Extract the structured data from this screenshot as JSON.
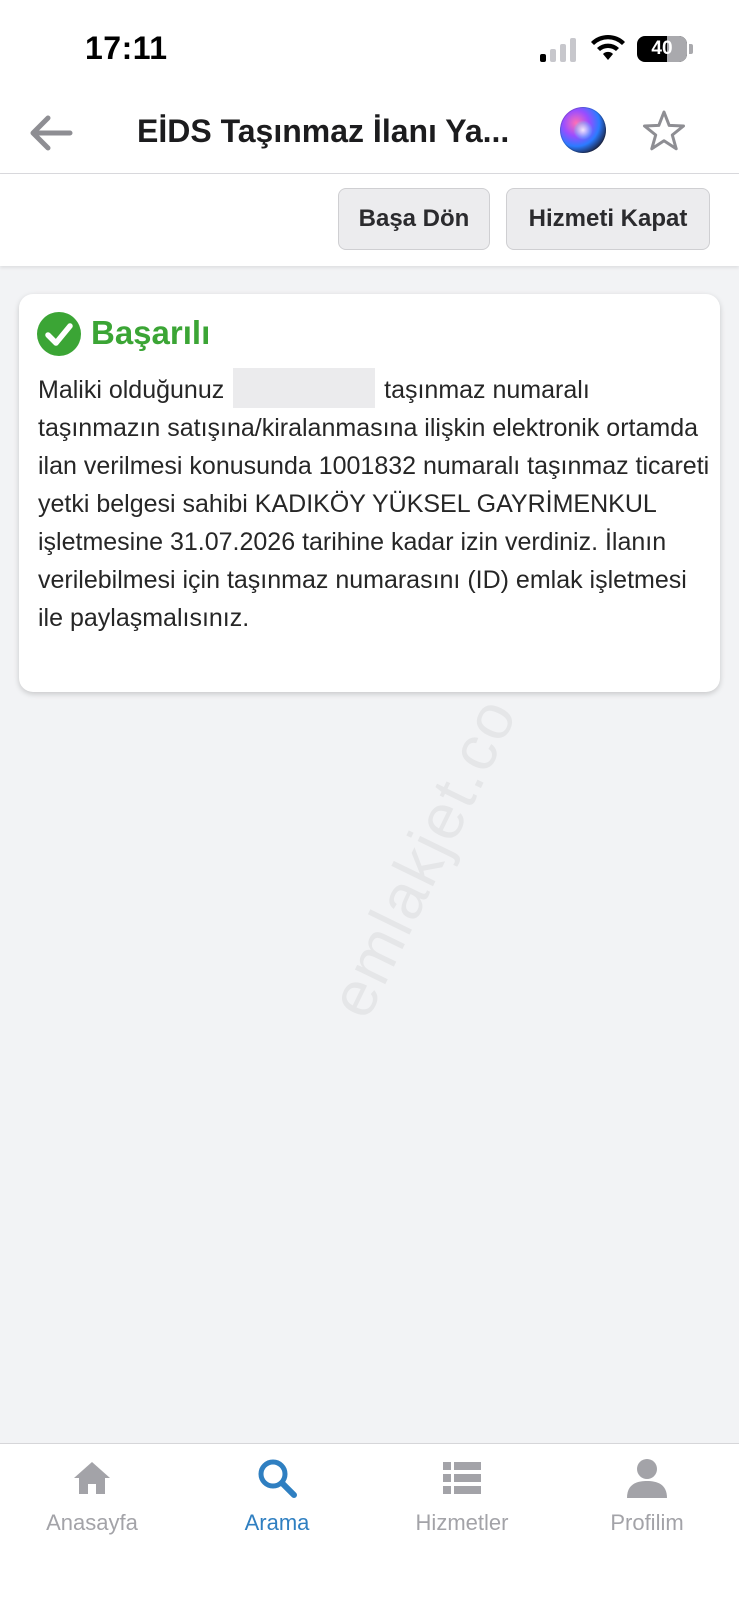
{
  "status_bar": {
    "time": "17:11",
    "battery_percent": "40"
  },
  "nav": {
    "title": "EİDS Taşınmaz İlanı Ya...",
    "back_icon": "arrow-left-icon",
    "siri_icon": "siri-icon",
    "favorite_icon": "star-outline-icon"
  },
  "toolbar": {
    "back_to_start_label": "Başa Dön",
    "close_service_label": "Hizmeti Kapat"
  },
  "result": {
    "title": "Başarılı",
    "text_before": "Maliki olduğunuz",
    "text_after": "taşınmaz numaralı taşınmazın satışına/kiralanmasına ilişkin elektronik ortamda ilan verilmesi konusunda 1001832 numaralı taşınmaz ticareti yetki belgesi sahibi KADIKÖY YÜKSEL GAYRİMENKUL işletmesine 31.07.2026 tarihine kadar izin verdiniz. İlanın verilebilmesi için taşınmaz numarasını (ID) emlak işletmesi ile paylaşmalısınız.",
    "success_color": "#3ba535"
  },
  "watermark": "emlakjet.co",
  "tabs": [
    {
      "label": "Anasayfa",
      "icon": "home-icon",
      "active": false
    },
    {
      "label": "Arama",
      "icon": "search-icon",
      "active": true
    },
    {
      "label": "Hizmetler",
      "icon": "list-icon",
      "active": false
    },
    {
      "label": "Profilim",
      "icon": "person-icon",
      "active": false
    }
  ],
  "colors": {
    "accent": "#2f7fc1",
    "inactive": "#a3a3a8",
    "background": "#f2f3f5"
  }
}
